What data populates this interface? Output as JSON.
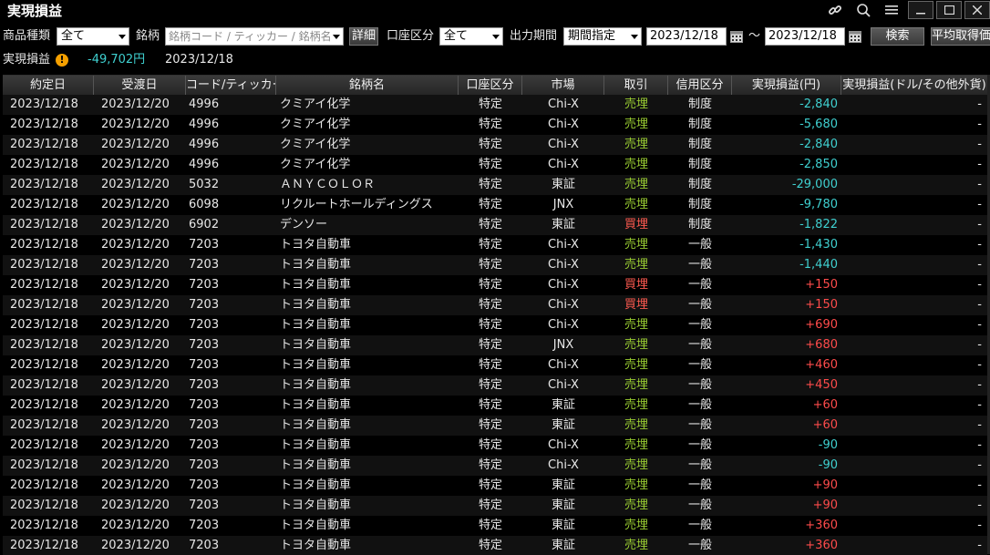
{
  "window": {
    "title": "実現損益"
  },
  "toolbar": {
    "product_label": "商品種類",
    "product_value": "全て",
    "brand_label": "銘柄",
    "brand_placeholder": "銘柄コード / ティッカー / 銘柄名",
    "detail_button": "詳細",
    "account_label": "口座区分",
    "account_value": "全て",
    "period_label": "出力期間",
    "period_value": "期間指定",
    "date_from": "2023/12/18",
    "tilde": "～",
    "date_to": "2023/12/18",
    "search_button": "検索",
    "avg_button": "平均取得価"
  },
  "summary": {
    "label": "実現損益",
    "warn_glyph": "!",
    "amount": "-49,702円",
    "date": "2023/12/18"
  },
  "table": {
    "columns": [
      "約定日",
      "受渡日",
      "コード/ティッカー",
      "銘柄名",
      "口座区分",
      "市場",
      "取引",
      "信用区分",
      "実現損益(円)",
      "実現損益(ドル/その他外貨)"
    ],
    "rows": [
      {
        "trade": "2023/12/18",
        "settle": "2023/12/20",
        "code": "4996",
        "name": "クミアイ化学",
        "account": "特定",
        "market": "Chi-X",
        "side": "売埋",
        "side_type": "sell",
        "credit": "制度",
        "pl": "-2,840",
        "pl_type": "neg",
        "fx": "-"
      },
      {
        "trade": "2023/12/18",
        "settle": "2023/12/20",
        "code": "4996",
        "name": "クミアイ化学",
        "account": "特定",
        "market": "Chi-X",
        "side": "売埋",
        "side_type": "sell",
        "credit": "制度",
        "pl": "-5,680",
        "pl_type": "neg",
        "fx": "-"
      },
      {
        "trade": "2023/12/18",
        "settle": "2023/12/20",
        "code": "4996",
        "name": "クミアイ化学",
        "account": "特定",
        "market": "Chi-X",
        "side": "売埋",
        "side_type": "sell",
        "credit": "制度",
        "pl": "-2,840",
        "pl_type": "neg",
        "fx": "-"
      },
      {
        "trade": "2023/12/18",
        "settle": "2023/12/20",
        "code": "4996",
        "name": "クミアイ化学",
        "account": "特定",
        "market": "Chi-X",
        "side": "売埋",
        "side_type": "sell",
        "credit": "制度",
        "pl": "-2,850",
        "pl_type": "neg",
        "fx": "-"
      },
      {
        "trade": "2023/12/18",
        "settle": "2023/12/20",
        "code": "5032",
        "name": "ＡＮＹＣＯＬＯＲ",
        "account": "特定",
        "market": "東証",
        "side": "売埋",
        "side_type": "sell",
        "credit": "制度",
        "pl": "-29,000",
        "pl_type": "neg",
        "fx": "-"
      },
      {
        "trade": "2023/12/18",
        "settle": "2023/12/20",
        "code": "6098",
        "name": "リクルートホールディングス",
        "account": "特定",
        "market": "JNX",
        "side": "売埋",
        "side_type": "sell",
        "credit": "制度",
        "pl": "-9,780",
        "pl_type": "neg",
        "fx": "-"
      },
      {
        "trade": "2023/12/18",
        "settle": "2023/12/20",
        "code": "6902",
        "name": "デンソー",
        "account": "特定",
        "market": "東証",
        "side": "買埋",
        "side_type": "buy",
        "credit": "制度",
        "pl": "-1,822",
        "pl_type": "neg",
        "fx": "-"
      },
      {
        "trade": "2023/12/18",
        "settle": "2023/12/20",
        "code": "7203",
        "name": "トヨタ自動車",
        "account": "特定",
        "market": "Chi-X",
        "side": "売埋",
        "side_type": "sell",
        "credit": "一般",
        "pl": "-1,430",
        "pl_type": "neg",
        "fx": "-"
      },
      {
        "trade": "2023/12/18",
        "settle": "2023/12/20",
        "code": "7203",
        "name": "トヨタ自動車",
        "account": "特定",
        "market": "Chi-X",
        "side": "売埋",
        "side_type": "sell",
        "credit": "一般",
        "pl": "-1,440",
        "pl_type": "neg",
        "fx": "-"
      },
      {
        "trade": "2023/12/18",
        "settle": "2023/12/20",
        "code": "7203",
        "name": "トヨタ自動車",
        "account": "特定",
        "market": "Chi-X",
        "side": "買埋",
        "side_type": "buy",
        "credit": "一般",
        "pl": "+150",
        "pl_type": "pos",
        "fx": "-"
      },
      {
        "trade": "2023/12/18",
        "settle": "2023/12/20",
        "code": "7203",
        "name": "トヨタ自動車",
        "account": "特定",
        "market": "Chi-X",
        "side": "買埋",
        "side_type": "buy",
        "credit": "一般",
        "pl": "+150",
        "pl_type": "pos",
        "fx": "-"
      },
      {
        "trade": "2023/12/18",
        "settle": "2023/12/20",
        "code": "7203",
        "name": "トヨタ自動車",
        "account": "特定",
        "market": "Chi-X",
        "side": "売埋",
        "side_type": "sell",
        "credit": "一般",
        "pl": "+690",
        "pl_type": "pos",
        "fx": "-"
      },
      {
        "trade": "2023/12/18",
        "settle": "2023/12/20",
        "code": "7203",
        "name": "トヨタ自動車",
        "account": "特定",
        "market": "JNX",
        "side": "売埋",
        "side_type": "sell",
        "credit": "一般",
        "pl": "+680",
        "pl_type": "pos",
        "fx": "-"
      },
      {
        "trade": "2023/12/18",
        "settle": "2023/12/20",
        "code": "7203",
        "name": "トヨタ自動車",
        "account": "特定",
        "market": "Chi-X",
        "side": "売埋",
        "side_type": "sell",
        "credit": "一般",
        "pl": "+460",
        "pl_type": "pos",
        "fx": "-"
      },
      {
        "trade": "2023/12/18",
        "settle": "2023/12/20",
        "code": "7203",
        "name": "トヨタ自動車",
        "account": "特定",
        "market": "Chi-X",
        "side": "売埋",
        "side_type": "sell",
        "credit": "一般",
        "pl": "+450",
        "pl_type": "pos",
        "fx": "-"
      },
      {
        "trade": "2023/12/18",
        "settle": "2023/12/20",
        "code": "7203",
        "name": "トヨタ自動車",
        "account": "特定",
        "market": "東証",
        "side": "売埋",
        "side_type": "sell",
        "credit": "一般",
        "pl": "+60",
        "pl_type": "pos",
        "fx": "-"
      },
      {
        "trade": "2023/12/18",
        "settle": "2023/12/20",
        "code": "7203",
        "name": "トヨタ自動車",
        "account": "特定",
        "market": "東証",
        "side": "売埋",
        "side_type": "sell",
        "credit": "一般",
        "pl": "+60",
        "pl_type": "pos",
        "fx": "-"
      },
      {
        "trade": "2023/12/18",
        "settle": "2023/12/20",
        "code": "7203",
        "name": "トヨタ自動車",
        "account": "特定",
        "market": "Chi-X",
        "side": "売埋",
        "side_type": "sell",
        "credit": "一般",
        "pl": "-90",
        "pl_type": "neg",
        "fx": "-"
      },
      {
        "trade": "2023/12/18",
        "settle": "2023/12/20",
        "code": "7203",
        "name": "トヨタ自動車",
        "account": "特定",
        "market": "Chi-X",
        "side": "売埋",
        "side_type": "sell",
        "credit": "一般",
        "pl": "-90",
        "pl_type": "neg",
        "fx": "-"
      },
      {
        "trade": "2023/12/18",
        "settle": "2023/12/20",
        "code": "7203",
        "name": "トヨタ自動車",
        "account": "特定",
        "market": "東証",
        "side": "売埋",
        "side_type": "sell",
        "credit": "一般",
        "pl": "+90",
        "pl_type": "pos",
        "fx": "-"
      },
      {
        "trade": "2023/12/18",
        "settle": "2023/12/20",
        "code": "7203",
        "name": "トヨタ自動車",
        "account": "特定",
        "market": "東証",
        "side": "売埋",
        "side_type": "sell",
        "credit": "一般",
        "pl": "+90",
        "pl_type": "pos",
        "fx": "-"
      },
      {
        "trade": "2023/12/18",
        "settle": "2023/12/20",
        "code": "7203",
        "name": "トヨタ自動車",
        "account": "特定",
        "market": "東証",
        "side": "売埋",
        "side_type": "sell",
        "credit": "一般",
        "pl": "+360",
        "pl_type": "pos",
        "fx": "-"
      },
      {
        "trade": "2023/12/18",
        "settle": "2023/12/20",
        "code": "7203",
        "name": "トヨタ自動車",
        "account": "特定",
        "market": "東証",
        "side": "売埋",
        "side_type": "sell",
        "credit": "一般",
        "pl": "+360",
        "pl_type": "pos",
        "fx": "-"
      }
    ]
  },
  "colors": {
    "sell": "#9acd32",
    "buy": "#ff5a50",
    "neg": "#3fd0d0",
    "pos": "#ff4b4b",
    "warn": "#f5a000"
  },
  "icons": [
    "link-icon",
    "search-icon",
    "menu-icon",
    "minimize-icon",
    "maximize-icon",
    "close-icon",
    "calendar-icon",
    "warning-icon"
  ]
}
